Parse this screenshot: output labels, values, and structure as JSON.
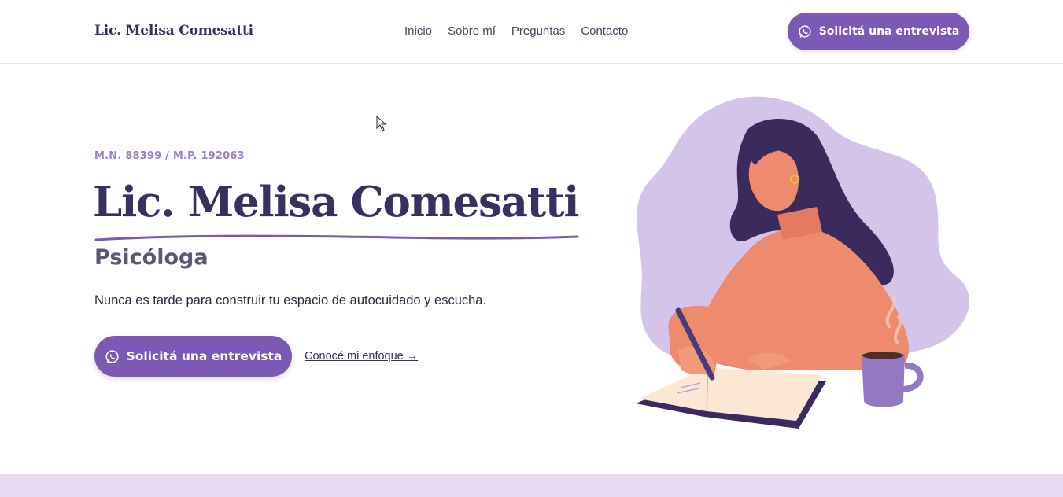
{
  "header": {
    "brand": "Lic. Melisa Comesatti",
    "nav": [
      "Inicio",
      "Sobre mí",
      "Preguntas",
      "Contacto"
    ],
    "cta_label": "Solicitá una entrevista"
  },
  "hero": {
    "credentials": "M.N. 88399 / M.P. 192063",
    "title": "Lic. Melisa Comesatti",
    "subtitle": "Psicóloga",
    "tagline": "Nunca es tarde para construir tu espacio de autocuidado y escucha.",
    "cta_label": "Solicitá una entrevista",
    "secondary_link": "Conocé mi enfoque →"
  },
  "icons": {
    "cta_icon": "whatsapp-icon",
    "illustration": "woman-writing-journal-illustration"
  },
  "colors": {
    "accent": "#7b59b5",
    "heading": "#3a2f5e",
    "credentials": "#9a80c9",
    "blob": "#d5c4ea",
    "sweater": "#ee8a6e",
    "hair": "#3b2b5c",
    "band": "#e6daf3"
  }
}
